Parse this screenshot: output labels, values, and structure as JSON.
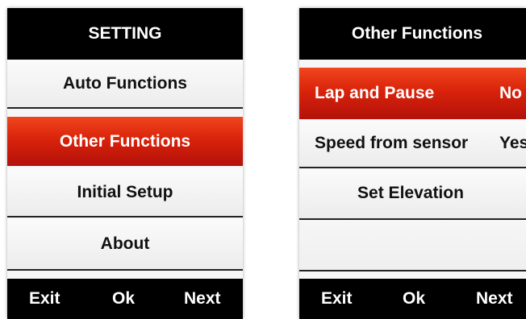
{
  "left_screen": {
    "title": "SETTING",
    "items": [
      {
        "label": "Auto Functions",
        "selected": false
      },
      {
        "label": "Other Functions",
        "selected": true
      },
      {
        "label": "Initial Setup",
        "selected": false
      },
      {
        "label": "About",
        "selected": false
      }
    ],
    "softkeys": {
      "left": "Exit",
      "center": "Ok",
      "right": "Next"
    }
  },
  "right_screen": {
    "title": "Other Functions",
    "items": [
      {
        "label": "Lap and Pause",
        "value": "No",
        "selected": true
      },
      {
        "label": "Speed from sensor",
        "value": "Yes",
        "selected": false
      },
      {
        "label": "Set Elevation",
        "selected": false
      }
    ],
    "softkeys": {
      "left": "Exit",
      "center": "Ok",
      "right": "Next"
    }
  },
  "colors": {
    "selection_red": "#d9230b",
    "bar_black": "#000000",
    "item_background": "#f6f6f6"
  }
}
